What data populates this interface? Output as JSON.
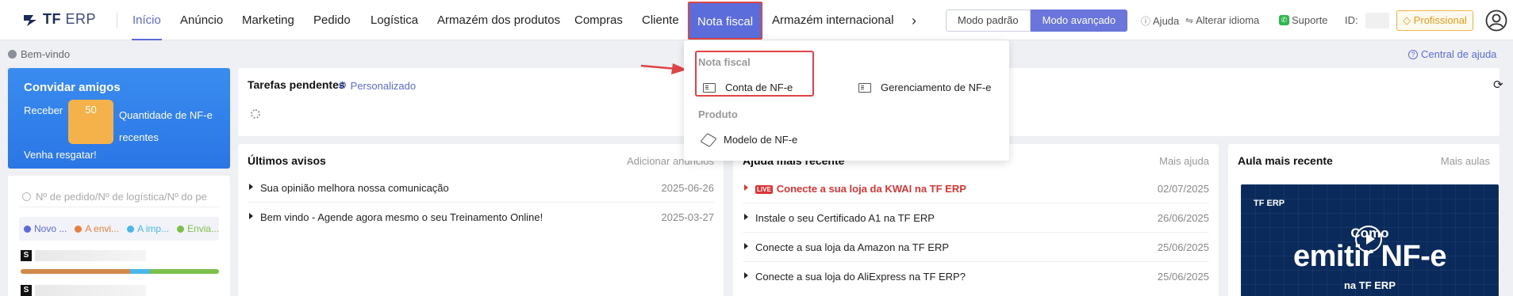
{
  "brand": {
    "name_bold": "TF",
    "name_light": " ERP"
  },
  "nav": {
    "items": [
      {
        "label": "Início",
        "active": true
      },
      {
        "label": "Anúncio"
      },
      {
        "label": "Marketing"
      },
      {
        "label": "Pedido"
      },
      {
        "label": "Logística"
      },
      {
        "label": "Armazém dos produtos"
      },
      {
        "label": "Compras"
      },
      {
        "label": "Cliente"
      },
      {
        "label": "Nota fiscal",
        "highlighted": true
      },
      {
        "label": "Armazém internacional"
      }
    ],
    "more_icon": "chevron-right-icon"
  },
  "modes": {
    "standard": "Modo padrão",
    "advanced": "Modo avançado"
  },
  "top_links": {
    "help": "Ajuda",
    "language": "Alterar idioma",
    "support": "Suporte",
    "id_label": "ID:"
  },
  "pro_button": "Profissional",
  "welcome": "Bem-vindo",
  "help_center": "Central de ajuda",
  "invite": {
    "title": "Convidar amigos",
    "receive": "Receber",
    "amount": "50",
    "desc": "Quantidade de NF-e recentes",
    "cta": "Venha resgatar!"
  },
  "search": {
    "placeholder": "Nº de pedido/Nº de logística/Nº do pe"
  },
  "statuses": [
    {
      "label": "Novo ...",
      "color": "#5c6bd9"
    },
    {
      "label": "A envi...",
      "color": "#e87f3a"
    },
    {
      "label": "A imp...",
      "color": "#48b8e8"
    },
    {
      "label": "Envia...",
      "color": "#7cbf4a"
    }
  ],
  "store_letter": "S",
  "pending": {
    "title": "Tarefas pendentes",
    "custom": "Personalizado"
  },
  "notices": {
    "title": "Últimos avisos",
    "link": "Adicionar anúncios",
    "rows": [
      {
        "text": "Sua opinião melhora nossa comunicação",
        "date": "2025-06-26"
      },
      {
        "text": "Bem vindo - Agende agora mesmo o seu Treinamento Online!",
        "date": "2025-03-27"
      }
    ]
  },
  "help": {
    "title": "Ajuda mais recente",
    "link": "Mais ajuda",
    "live_badge": "LIVE",
    "rows": [
      {
        "text": "Conecte a sua loja da KWAI na TF ERP",
        "date": "02/07/2025",
        "featured": true
      },
      {
        "text": "Instale o seu Certificado A1 na TF ERP",
        "date": "26/06/2025"
      },
      {
        "text": "Conecte a sua loja da Amazon na TF ERP",
        "date": "25/06/2025"
      },
      {
        "text": "Conecte a sua loja do AliExpress na TF ERP?",
        "date": "25/06/2025"
      }
    ]
  },
  "course": {
    "title": "Aula mais recente",
    "link": "Mais aulas",
    "thumb": {
      "brand": "TF ERP",
      "line1": "Como",
      "line2": "emitir NF-e",
      "line3": "na TF ERP"
    }
  },
  "dropdown": {
    "group1": "Nota fiscal",
    "item1": "Conta de NF-e",
    "item2": "Gerenciamento de NF-e",
    "group2": "Produto",
    "item3": "Modelo de NF-e"
  },
  "colors": {
    "accent": "#5c6bd9",
    "highlight": "#e04444",
    "invite_bg": "#2a76e6",
    "pro": "#e89a1a"
  }
}
